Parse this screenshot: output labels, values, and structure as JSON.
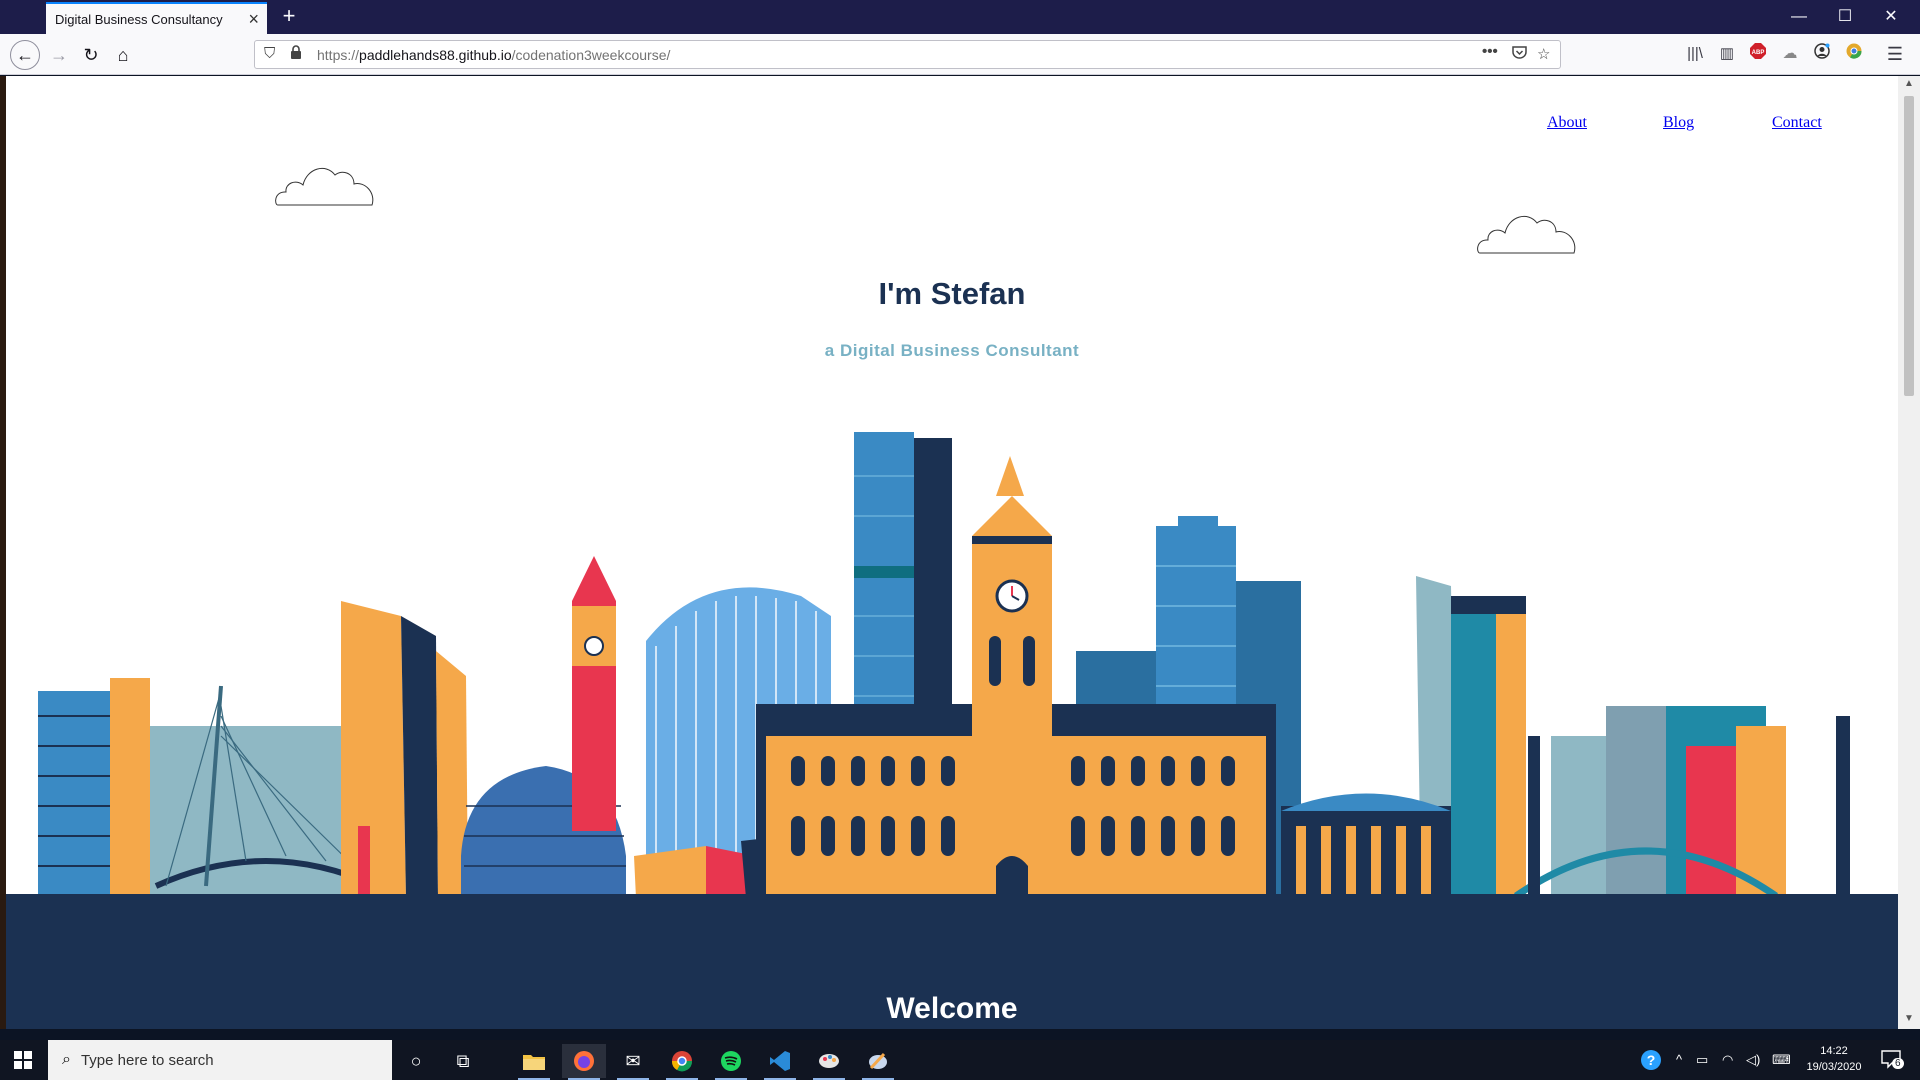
{
  "browser": {
    "tab_title": "Digital Business Consultancy",
    "url_protocol": "https://",
    "url_host": "paddlehands88.github.io",
    "url_path": "/codenation3weekcourse/"
  },
  "page": {
    "nav": [
      "About",
      "Blog",
      "Contact"
    ],
    "hero_title": "I'm Stefan",
    "hero_subtitle": "a Digital Business Consultant",
    "welcome": "Welcome"
  },
  "taskbar": {
    "search_placeholder": "Type here to search",
    "time": "14:22",
    "date": "19/03/2020",
    "notification_count": "6"
  },
  "colors": {
    "navy": "#1b3152",
    "teal": "#78b1c4",
    "orange": "#f5a84a",
    "red": "#e8364f",
    "blue": "#3a8ac4"
  }
}
